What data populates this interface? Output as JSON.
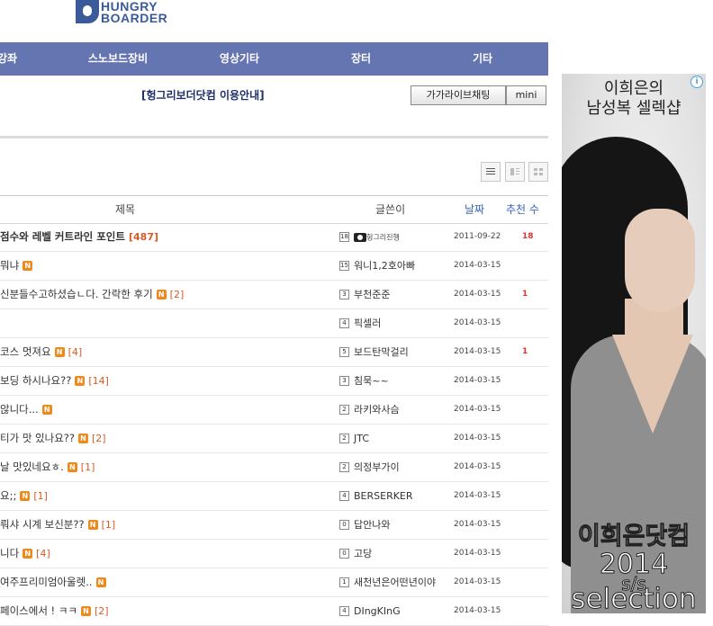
{
  "logo": {
    "line1": "HUNGRY",
    "line2": "BOARDER"
  },
  "nav": [
    "강좌",
    "스노보드장비",
    "영상기타",
    "장터",
    "기타"
  ],
  "notice": "[헝그리보더닷컴 이용안내]",
  "buttons": {
    "chat": "가가라이브채팅",
    "mini": "mini"
  },
  "table": {
    "headers": {
      "title": "제목",
      "writer": "글쓴이",
      "date": "날짜",
      "recommend": "추천 수"
    },
    "rows": [
      {
        "title": "점수와 레벨 커트라인 포인트",
        "bold": true,
        "new": false,
        "comments": "[487]",
        "level": "18",
        "writer": "헝그리진행",
        "writer_camera": true,
        "date": "2011-09-22",
        "rec": "18"
      },
      {
        "title": "뭐냐",
        "bold": false,
        "new": true,
        "comments": "",
        "level": "15",
        "writer": "워니1,2호아빠",
        "date": "2014-03-15",
        "rec": ""
      },
      {
        "title": "신분들수고하셨습ㄴ다. 간락한 후기",
        "bold": false,
        "new": true,
        "comments": "[2]",
        "level": "3",
        "writer": "부천준준",
        "date": "2014-03-15",
        "rec": "1"
      },
      {
        "title": "",
        "bold": false,
        "new": false,
        "comments": "",
        "level": "4",
        "writer": "픽셀러",
        "date": "2014-03-15",
        "rec": ""
      },
      {
        "title": "코스 멋져요",
        "bold": false,
        "new": true,
        "comments": "[4]",
        "level": "5",
        "writer": "보드탄막걸리",
        "date": "2014-03-15",
        "rec": "1"
      },
      {
        "title": "보딩 하시나요??",
        "bold": false,
        "new": true,
        "comments": "[14]",
        "level": "3",
        "writer": "침묵~~",
        "date": "2014-03-15",
        "rec": ""
      },
      {
        "title": "않니다...",
        "bold": false,
        "new": true,
        "comments": "",
        "level": "2",
        "writer": "라키와사슴",
        "date": "2014-03-15",
        "rec": ""
      },
      {
        "title": "티가 맛 있나요??",
        "bold": false,
        "new": true,
        "comments": "[2]",
        "level": "2",
        "writer": "JTC",
        "date": "2014-03-15",
        "rec": ""
      },
      {
        "title": "날 맛있네요ㅎ.",
        "bold": false,
        "new": true,
        "comments": "[1]",
        "level": "2",
        "writer": "의정부가이",
        "date": "2014-03-15",
        "rec": ""
      },
      {
        "title": "요;;",
        "bold": false,
        "new": true,
        "comments": "[1]",
        "level": "4",
        "writer": "BERSERKER",
        "date": "2014-03-15",
        "rec": ""
      },
      {
        "title": "뤄샤 시계 보신분??",
        "bold": false,
        "new": true,
        "comments": "[1]",
        "level": "0",
        "writer": "답안나와",
        "date": "2014-03-15",
        "rec": ""
      },
      {
        "title": "니다",
        "bold": false,
        "new": true,
        "comments": "[4]",
        "level": "0",
        "writer": "고당",
        "date": "2014-03-15",
        "rec": ""
      },
      {
        "title": "여주프리미엄아울렛..",
        "bold": false,
        "new": true,
        "comments": "",
        "level": "1",
        "writer": "새천년은어떤년이야",
        "date": "2014-03-15",
        "rec": ""
      },
      {
        "title": "페이스에서 ! ㅋㅋ",
        "bold": false,
        "new": true,
        "comments": "[2]",
        "level": "4",
        "writer": "DIngKInG",
        "date": "2014-03-15",
        "rec": ""
      }
    ]
  },
  "ad": {
    "headline1": "이희은의",
    "headline2": "남성복 셀렉샵",
    "brand": "이희은닷컴",
    "year": "2014",
    "season": "s/s",
    "tagline": "selection",
    "info_icon": "i"
  },
  "new_badge": "N"
}
